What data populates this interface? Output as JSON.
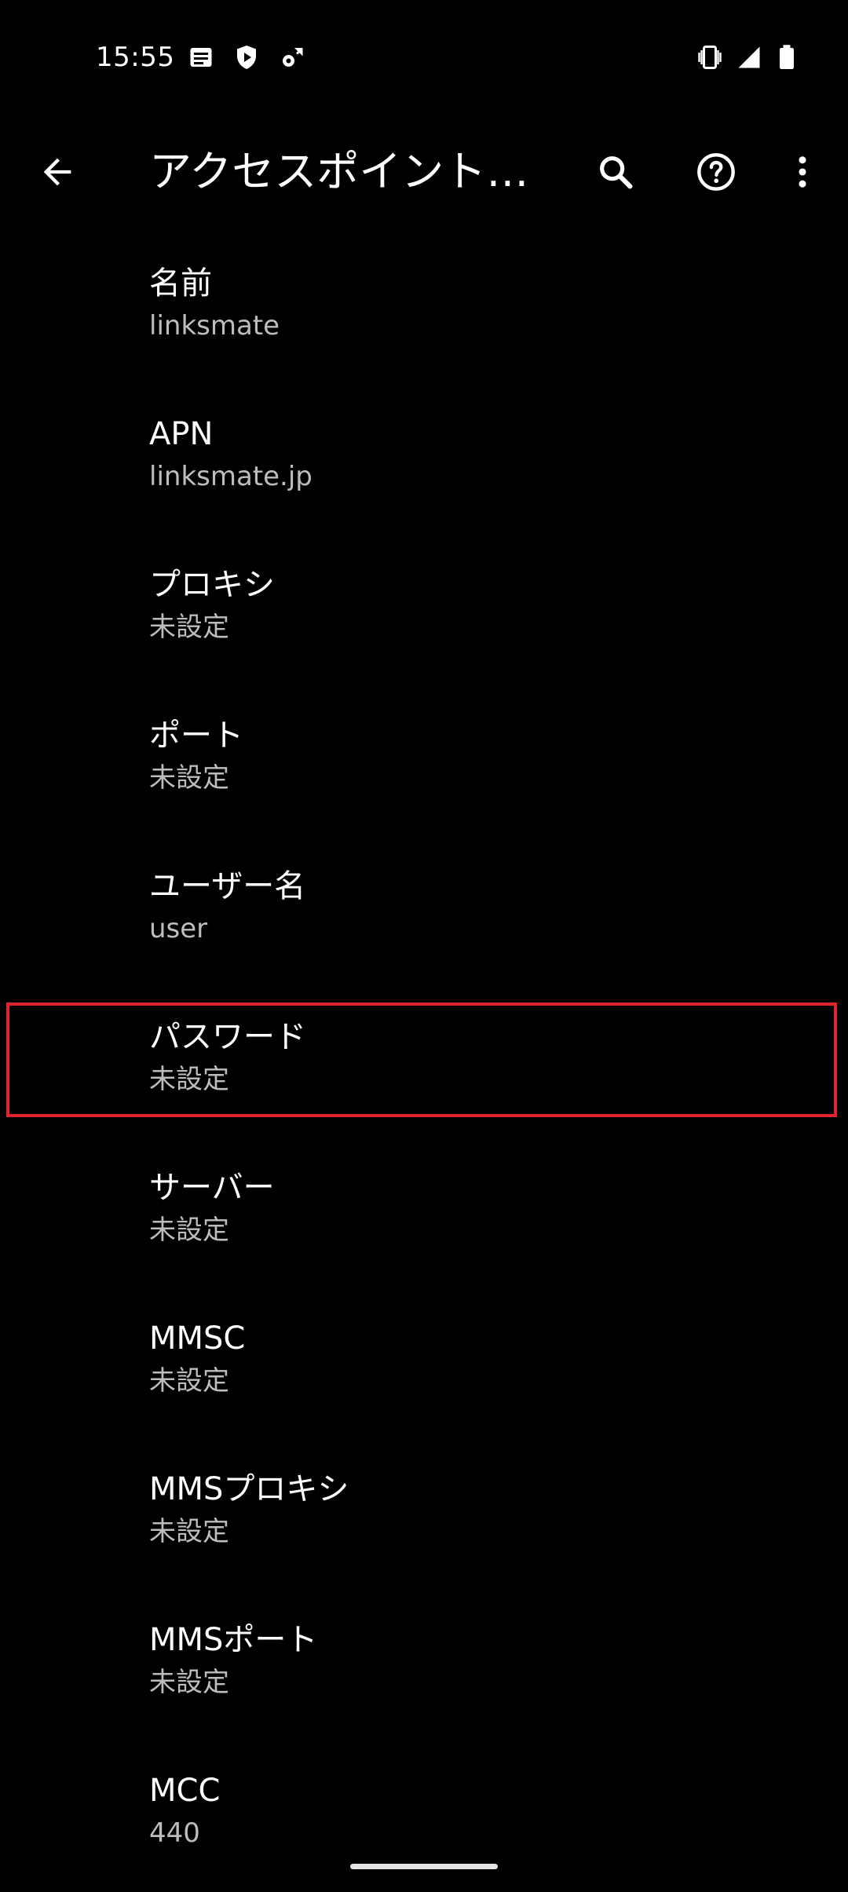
{
  "status_bar": {
    "time": "15:55",
    "left_icons": [
      "news-icon",
      "shield-play-icon",
      "settings-sync-icon"
    ],
    "right_icons": [
      "vibrate-icon",
      "signal-icon",
      "battery-icon"
    ]
  },
  "app_bar": {
    "title": "アクセスポイントの…",
    "back_icon": "arrow-back-icon",
    "search_icon": "search-icon",
    "help_icon": "help-circle-icon",
    "more_icon": "more-vert-icon"
  },
  "preferences": [
    {
      "title": "名前",
      "summary": "linksmate"
    },
    {
      "title": "APN",
      "summary": "linksmate.jp"
    },
    {
      "title": "プロキシ",
      "summary": "未設定"
    },
    {
      "title": "ポート",
      "summary": "未設定"
    },
    {
      "title": "ユーザー名",
      "summary": "user"
    },
    {
      "title": "パスワード",
      "summary": "未設定"
    },
    {
      "title": "サーバー",
      "summary": "未設定"
    },
    {
      "title": "MMSC",
      "summary": "未設定"
    },
    {
      "title": "MMSプロキシ",
      "summary": "未設定"
    },
    {
      "title": "MMSポート",
      "summary": "未設定"
    },
    {
      "title": "MCC",
      "summary": "440"
    }
  ],
  "colors": {
    "background": "#000000",
    "title_text": "#ffffff",
    "summary_text": "#bdbdbd",
    "highlight": "#e0242e"
  }
}
